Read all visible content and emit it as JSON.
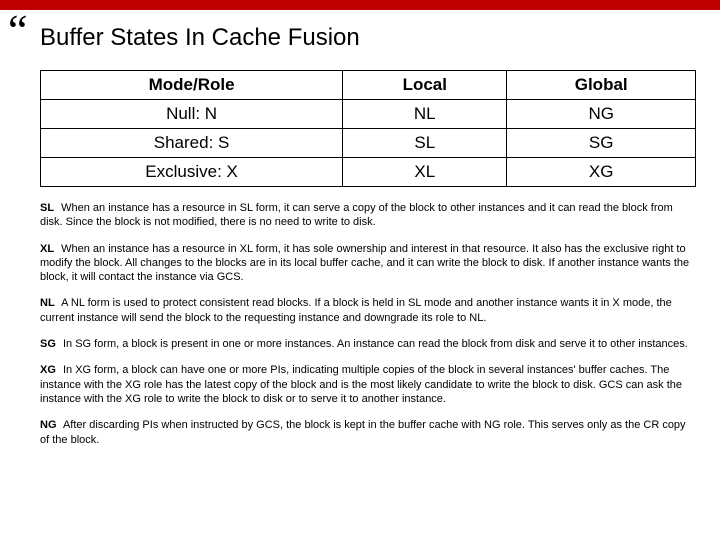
{
  "title": "Buffer States In Cache Fusion",
  "table": {
    "headers": [
      "Mode/Role",
      "Local",
      "Global"
    ],
    "rows": [
      {
        "mode": "Null: N",
        "local": "NL",
        "global": "NG"
      },
      {
        "mode": "Shared: S",
        "local": "SL",
        "global": "SG"
      },
      {
        "mode": "Exclusive: X",
        "local": "XL",
        "global": "XG"
      }
    ]
  },
  "defs": [
    {
      "term": "SL",
      "text": "When an instance has a resource in SL form, it can serve a copy of the block to other instances and it can read the block from disk. Since the block is not modified, there is no need to write to disk."
    },
    {
      "term": "XL",
      "text": "When an instance has a resource in XL form, it has sole ownership and interest in that resource. It also has the exclusive right to modify the block. All changes to the blocks are in its local buffer cache, and it can write the block to disk. If another instance wants the block, it will contact the instance via GCS."
    },
    {
      "term": "NL",
      "text": "A NL form is used to protect consistent read blocks. If a block is held in SL mode and another instance wants it in X mode, the current instance will send the block to the requesting instance and downgrade its role to NL."
    },
    {
      "term": "SG",
      "text": "In SG form, a block is present in one or more instances. An instance can read the block from disk and serve it to other instances."
    },
    {
      "term": "XG",
      "text": "In XG form, a block can have one or more PIs, indicating multiple copies of the block in several instances' buffer caches. The instance with the XG role has the latest copy of the block and is the most likely candidate to write the block to disk. GCS can ask the instance with the XG role to write the block to disk or to serve it to another instance."
    },
    {
      "term": "NG",
      "text": "After discarding PIs when instructed by GCS, the block is kept in the buffer cache with NG role. This serves only as the CR copy of the block."
    }
  ]
}
